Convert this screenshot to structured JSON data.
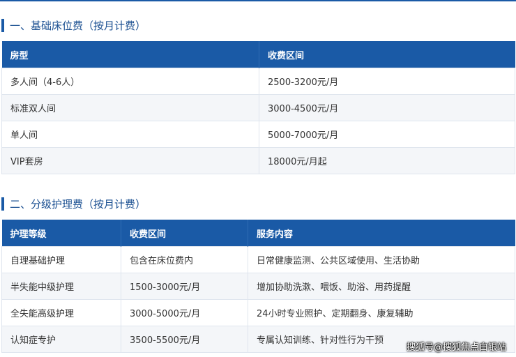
{
  "section1": {
    "title": "一、基础床位费（按月计费）",
    "headers": [
      "房型",
      "收费区间"
    ],
    "rows": [
      [
        "多人间（4-6人）",
        "2500-3200元/月"
      ],
      [
        "标准双人间",
        "3000-4500元/月"
      ],
      [
        "单人间",
        "5000-7000元/月"
      ],
      [
        "VIP套房",
        "18000元/月起"
      ]
    ]
  },
  "section2": {
    "title": "二、分级护理费（按月计费）",
    "headers": [
      "护理等级",
      "收费区间",
      "服务内容"
    ],
    "rows": [
      [
        "自理基础护理",
        "包含在床位费内",
        "日常健康监测、公共区域使用、生活协助"
      ],
      [
        "半失能中级护理",
        "1500-3000元/月",
        "增加协助洗漱、喂饭、助浴、用药提醒"
      ],
      [
        "全失能高级护理",
        "3000-5000元/月",
        "24小时专业照护、定期翻身、康复辅助"
      ],
      [
        "认知症专护",
        "3500-5500元/月",
        "专属认知训练、针对性行为干预"
      ]
    ]
  },
  "watermark": "搜狐号@搜狐焦点白银站",
  "colors": {
    "accent": "#1a5aa6",
    "row_alt": "#f4f6f9",
    "title": "#1a4f91"
  }
}
